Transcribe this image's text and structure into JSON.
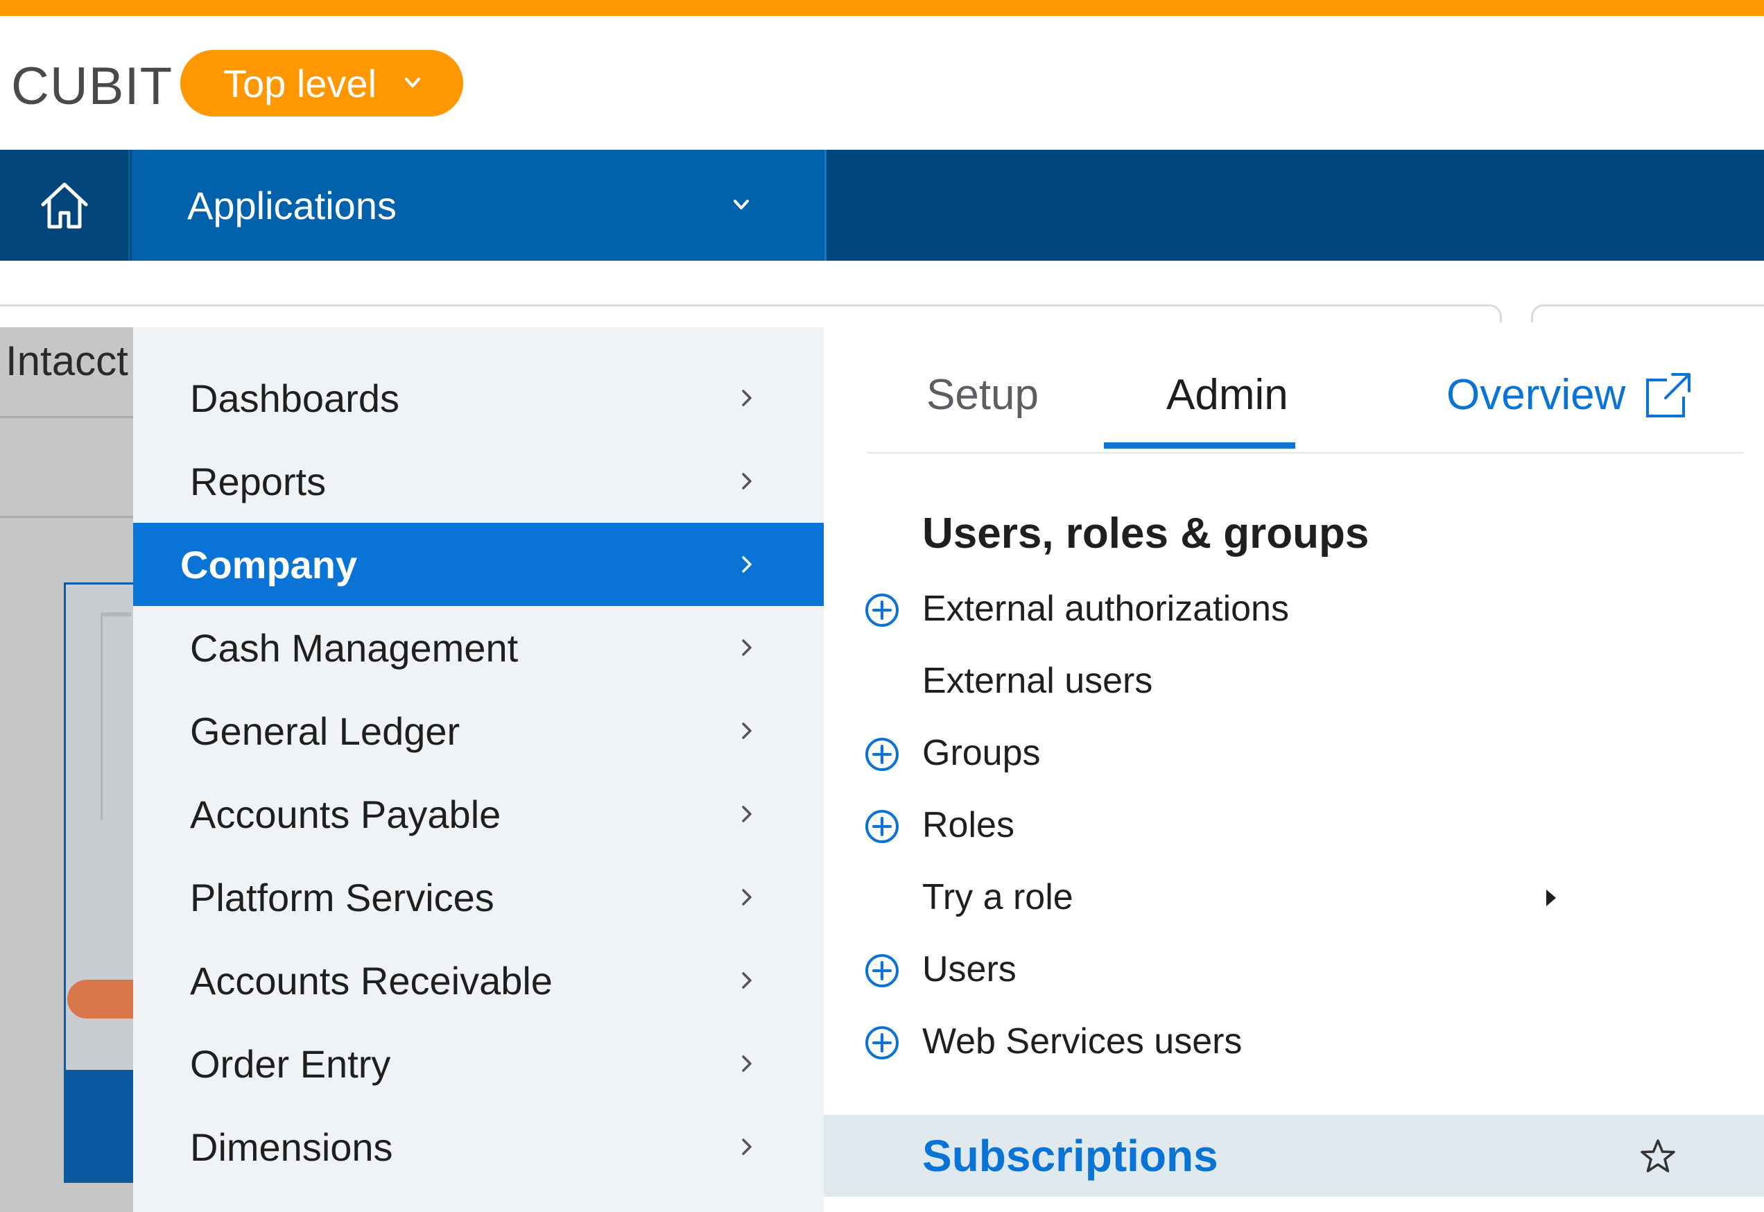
{
  "header": {
    "brand": "CUBIT",
    "level_label": "Top level",
    "accent_color": "#ff9800"
  },
  "navbar": {
    "home_icon": "home-icon",
    "applications_label": "Applications",
    "background_color": "#00467e"
  },
  "background": {
    "left_title": "Intacct"
  },
  "menu": {
    "items": [
      {
        "label": "Dashboards",
        "active": false
      },
      {
        "label": "Reports",
        "active": false
      },
      {
        "label": "Company",
        "active": true
      },
      {
        "label": "Cash Management",
        "active": false
      },
      {
        "label": "General Ledger",
        "active": false
      },
      {
        "label": "Accounts Payable",
        "active": false
      },
      {
        "label": "Platform Services",
        "active": false
      },
      {
        "label": "Accounts Receivable",
        "active": false
      },
      {
        "label": "Order Entry",
        "active": false
      },
      {
        "label": "Dimensions",
        "active": false
      }
    ],
    "active_color": "#0a74d6"
  },
  "submenu": {
    "tabs": [
      {
        "label": "Setup",
        "selected": false
      },
      {
        "label": "Admin",
        "selected": true
      }
    ],
    "overview_label": "Overview",
    "section_title": "Users, roles & groups",
    "items": [
      {
        "label": "External authorizations",
        "icon": "plus-circle-icon"
      },
      {
        "label": "External users",
        "icon": ""
      },
      {
        "label": "Groups",
        "icon": "plus-circle-icon"
      },
      {
        "label": "Roles",
        "icon": "plus-circle-icon"
      },
      {
        "label": "Try a role",
        "icon": "",
        "submenu_arrow": "caret-right-icon"
      },
      {
        "label": "Users",
        "icon": "plus-circle-icon"
      },
      {
        "label": "Web Services users",
        "icon": "plus-circle-icon"
      }
    ],
    "highlighted_item": {
      "label": "Subscriptions",
      "icon": "star-icon"
    }
  }
}
